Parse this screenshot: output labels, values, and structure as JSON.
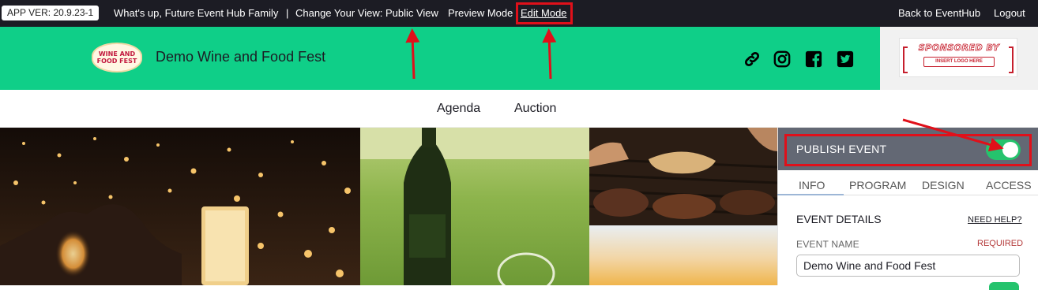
{
  "topbar": {
    "app_version": "APP VER: 20.9.23-1",
    "greeting": "What's up, Future Event Hub Family",
    "separator": "|",
    "change_view": "Change Your View: Public View",
    "preview_mode": "Preview Mode",
    "edit_mode": "Edit Mode",
    "back_link": "Back to EventHub",
    "logout": "Logout"
  },
  "header": {
    "logo_text_line1": "WINE AND",
    "logo_text_line2": "FOOD FEST",
    "event_title": "Demo Wine and Food Fest",
    "social_icons": [
      "link-icon",
      "instagram-icon",
      "facebook-icon",
      "twitter-icon"
    ],
    "sponsor_title": "SPONSORED BY",
    "sponsor_sub": "INSERT LOGO HERE"
  },
  "nav": {
    "items": [
      "Agenda",
      "Auction"
    ]
  },
  "panel": {
    "publish_label": "PUBLISH EVENT",
    "publish_on": true,
    "tabs": [
      "INFO",
      "PROGRAM",
      "DESIGN",
      "ACCESS"
    ],
    "active_tab": "INFO",
    "section_title": "EVENT DETAILS",
    "help_link": "NEED HELP?",
    "field_label": "EVENT NAME",
    "required_label": "REQUIRED",
    "field_value": "Demo Wine and Food Fest"
  },
  "colors": {
    "topbar_bg": "#1c1c24",
    "header_green": "#0fcf88",
    "toggle_green": "#25c36d",
    "publish_bg": "#636874",
    "highlight_red": "#e0101a"
  }
}
